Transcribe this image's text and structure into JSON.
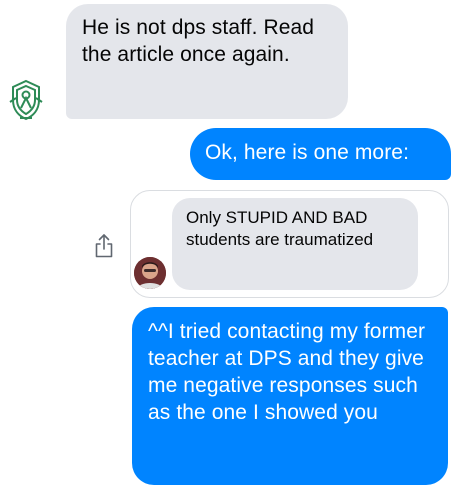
{
  "colors": {
    "incoming_bubble": "#e4e6eb",
    "outgoing_bubble": "#0084ff",
    "outgoing_text": "#ffffff",
    "card_border": "#dadde1",
    "logo_green": "#2e8b57"
  },
  "icons": {
    "page_avatar": "green-crest-logo",
    "share": "share-icon"
  },
  "messages": [
    {
      "direction": "incoming",
      "text": "He is not dps staff. Read the article once again."
    },
    {
      "direction": "outgoing",
      "text": "Ok, here is one more:"
    },
    {
      "direction": "outgoing",
      "type": "shared-message",
      "quoted_text": "Only STUPID AND BAD students are traumatized"
    },
    {
      "direction": "outgoing",
      "text": "^^I tried contacting my former teacher at DPS and they give me negative responses such as the one I showed you"
    }
  ]
}
